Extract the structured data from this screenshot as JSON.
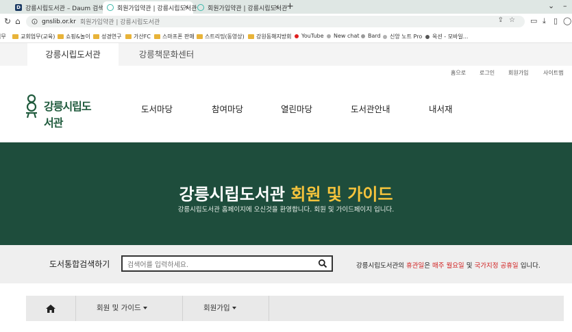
{
  "browser": {
    "tabs": [
      {
        "title": "강릉시립도서관 – Daum 검색",
        "favicon": "daum-icon",
        "active": false
      },
      {
        "title": "회원가입약관 | 강릉시립도서관",
        "favicon": "library-ring-icon",
        "active": true
      },
      {
        "title": "회원가입약관 | 강릉시립도서관",
        "favicon": "library-ring-icon",
        "active": false
      }
    ],
    "new_tab": "+",
    "url": "gnslib.or.kr",
    "page_title": "회원가입약관 | 강릉시립도서관",
    "bookmarks": [
      {
        "label": "업무",
        "icon": "folder-icon"
      },
      {
        "label": "교회업무(교육)",
        "icon": "folder-icon"
      },
      {
        "label": "쇼핑&놀이",
        "icon": "folder-icon"
      },
      {
        "label": "성경연구",
        "icon": "folder-icon"
      },
      {
        "label": "가산FC",
        "icon": "folder-icon"
      },
      {
        "label": "스마프폰 판매",
        "icon": "folder-icon"
      },
      {
        "label": "스트리밍(동영상)",
        "icon": "folder-icon"
      },
      {
        "label": "강원동해지방회",
        "icon": "folder-icon"
      },
      {
        "label": "YouTube",
        "icon": "youtube-icon",
        "color": "#e02020"
      },
      {
        "label": "New chat",
        "icon": "chatgpt-icon",
        "color": "#aaaaaa"
      },
      {
        "label": "Bard",
        "icon": "bard-icon",
        "color": "#9a9a9a"
      },
      {
        "label": "신앙 노트 Pro",
        "icon": "note-icon",
        "color": "#b0b0b0"
      },
      {
        "label": "옥션 - 모바일...",
        "icon": "auction-icon",
        "color": "#555555"
      }
    ]
  },
  "site": {
    "tabs": [
      "강릉시립도서관",
      "강릉책문화센터"
    ],
    "util_links": [
      "홈으로",
      "로그인",
      "회원가입",
      "사이트맵"
    ],
    "logo_text": "강릉시립도서관",
    "gnb": [
      "도서마당",
      "참여마당",
      "열린마당",
      "도서관안내",
      "내서재"
    ],
    "hero": {
      "title_main": "강릉시립도서관",
      "title_accent": "회원 및 가이드",
      "subtitle": "강릉시립도서관 홈페이지에 오신것을 환영합니다. 회원 및 가이드페이지 입니다."
    },
    "search": {
      "label": "도서통합검색하기",
      "placeholder": "검색어를 입력하세요.",
      "value": ""
    },
    "notice": {
      "p1": "강릉시립도서관의 ",
      "p2": "휴관일",
      "p3": "은 ",
      "p4": "매주 월요일",
      "p5": " 및 ",
      "p6": "국가지정 공휴일",
      "p7": " 입니다."
    },
    "subnav": [
      "회원 및 가이드",
      "회원가입"
    ],
    "colors": {
      "hero_bg": "#1e4d3c",
      "accent_yellow": "#f6c43c",
      "notice_red": "#d01d1d",
      "logo_green": "#1f5a3c"
    }
  }
}
